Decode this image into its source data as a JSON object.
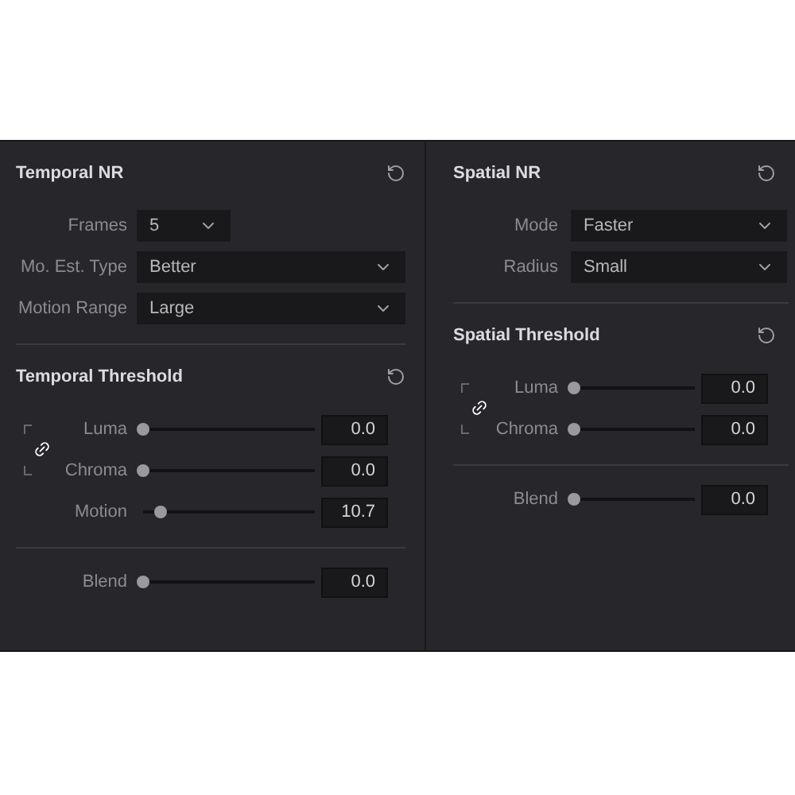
{
  "columns": [
    {
      "sections": [
        {
          "title": "Temporal NR",
          "rows": [
            {
              "kind": "dropdown",
              "label": "Frames",
              "value": "5",
              "compact": true
            },
            {
              "kind": "dropdown",
              "label": "Mo. Est. Type",
              "value": "Better",
              "compact": false
            },
            {
              "kind": "dropdown",
              "label": "Motion Range",
              "value": "Large",
              "compact": false
            }
          ]
        },
        {
          "title": "Temporal Threshold",
          "rows": [
            {
              "kind": "linked",
              "sliders": [
                {
                  "label": "Luma",
                  "value": "0.0",
                  "level": 0
                },
                {
                  "label": "Chroma",
                  "value": "0.0",
                  "level": 0
                }
              ]
            },
            {
              "kind": "slider",
              "label": "Motion",
              "value": "10.7",
              "level": 0.1
            }
          ]
        },
        {
          "rows": [
            {
              "kind": "slider",
              "label": "Blend",
              "value": "0.0",
              "level": 0
            }
          ]
        }
      ]
    },
    {
      "sections": [
        {
          "title": "Spatial NR",
          "rows": [
            {
              "kind": "dropdown",
              "label": "Mode",
              "value": "Faster",
              "compact": false
            },
            {
              "kind": "dropdown",
              "label": "Radius",
              "value": "Small",
              "compact": false
            }
          ]
        },
        {
          "title": "Spatial Threshold",
          "rows": [
            {
              "kind": "linked",
              "sliders": [
                {
                  "label": "Luma",
                  "value": "0.0",
                  "level": 0
                },
                {
                  "label": "Chroma",
                  "value": "0.0",
                  "level": 0
                }
              ]
            }
          ]
        },
        {
          "rows": [
            {
              "kind": "slider",
              "label": "Blend",
              "value": "0.0",
              "level": 0
            }
          ]
        }
      ]
    }
  ]
}
